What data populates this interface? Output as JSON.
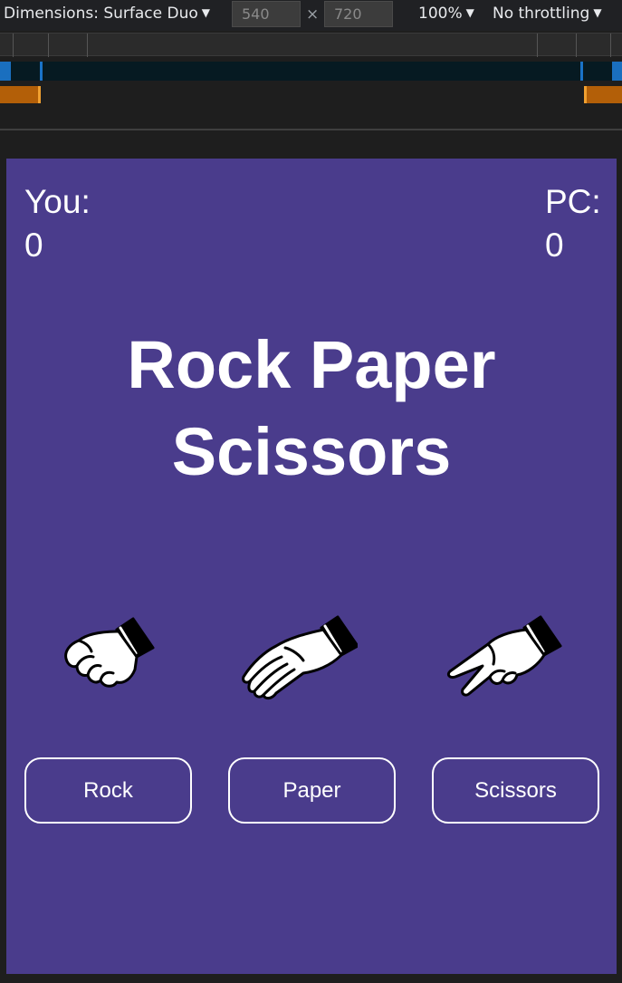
{
  "devtools": {
    "dimensions_label": "Dimensions: Surface Duo",
    "width_value": "540",
    "height_value": "720",
    "times_symbol": "×",
    "zoom": "100%",
    "throttling": "No throttling",
    "caret": "▼"
  },
  "game": {
    "you_label": "You:",
    "you_score": "0",
    "pc_label": "PC:",
    "pc_score": "0",
    "title_line1": "Rock Paper",
    "title_line2": "Scissors",
    "hands": [
      {
        "name": "rock",
        "icon": "fist-hand-icon"
      },
      {
        "name": "paper",
        "icon": "open-hand-icon"
      },
      {
        "name": "scissors",
        "icon": "peace-hand-icon"
      }
    ],
    "buttons": {
      "rock": "Rock",
      "paper": "Paper",
      "scissors": "Scissors"
    }
  },
  "colors": {
    "app_background": "#4a3c8c",
    "text": "#ffffff",
    "devtools_background": "#202124"
  }
}
